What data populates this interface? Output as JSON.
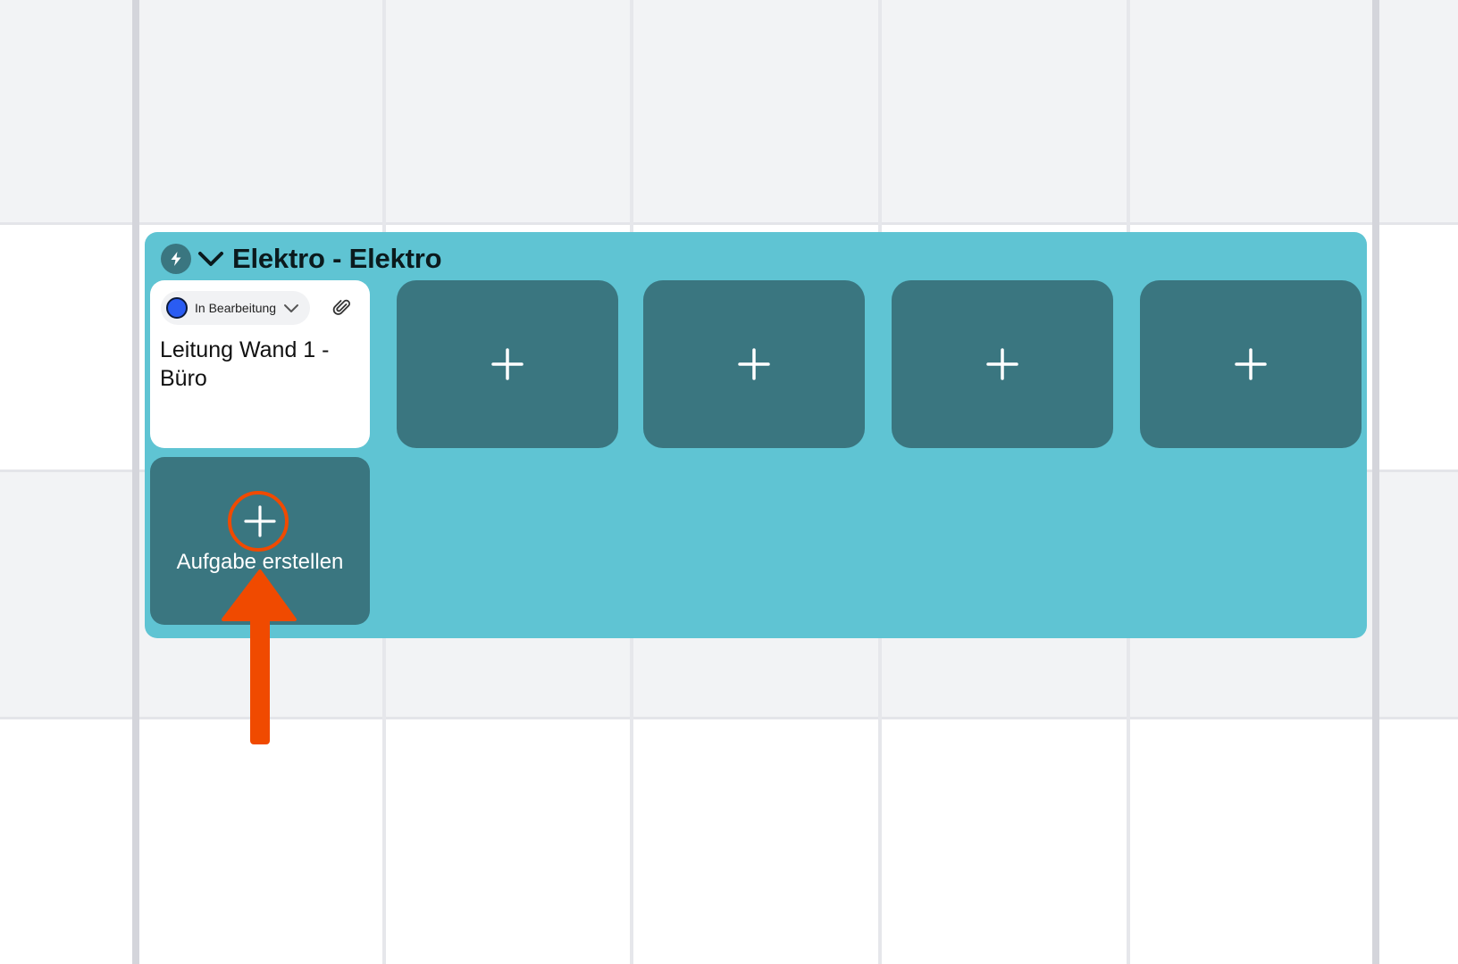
{
  "group": {
    "title": "Elektro - Elektro",
    "color": "#5fc4d3",
    "slot_color": "#3a7680",
    "icons": [
      "lightning-icon",
      "chevron-down-icon"
    ]
  },
  "task": {
    "status": "In Bearbeitung",
    "status_color": "#2a5cf2",
    "title": "Leitung Wand 1 - Büro",
    "icons": [
      "chevron-down-icon",
      "paperclip-icon"
    ]
  },
  "empty_slots": {
    "count": 4,
    "icon": "plus-icon"
  },
  "create_task": {
    "label": "Aufgabe erstellen",
    "icon": "plus-icon"
  },
  "annotation": {
    "color": "#f04a00",
    "icons": [
      "highlight-circle",
      "arrow-up-icon"
    ]
  }
}
